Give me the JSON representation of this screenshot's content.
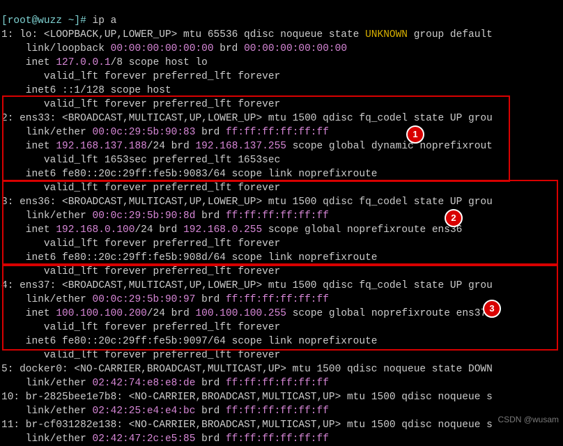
{
  "prompt": "[root@wuzz ~]# ",
  "command": "ip a",
  "watermark": "CSDN @wusam",
  "iface1": {
    "header_a": "1: lo: <LOOPBACK,UP,LOWER_UP> mtu 65536 qdisc noqueue state ",
    "state": "UNKNOWN",
    "header_b": " group default",
    "link_a": "    link/loopback ",
    "mac": "00:00:00:00:00:00",
    "link_b": " brd ",
    "brd": "00:00:00:00:00:00",
    "inet_a": "    inet ",
    "inet_ip": "127.0.0.1",
    "inet_b": "/8 scope host lo",
    "valid": "       valid_lft forever preferred_lft forever",
    "inet6": "    inet6 ::1/128 scope host",
    "valid6": "       valid_lft forever preferred_lft forever"
  },
  "iface2": {
    "header": "2: ens33: <BROADCAST,MULTICAST,UP,LOWER_UP> mtu 1500 qdisc fq_codel state UP grou",
    "link_a": "    link/ether ",
    "mac": "00:0c:29:5b:90:83",
    "link_b": " brd ",
    "brd": "ff:ff:ff:ff:ff:ff",
    "inet_a": "    inet ",
    "inet_ip": "192.168.137.188",
    "inet_b": "/24 brd ",
    "inet_brd": "192.168.137.255",
    "inet_c": " scope global dynamic noprefixrout",
    "valid": "       valid_lft 1653sec preferred_lft 1653sec",
    "inet6": "    inet6 fe80::20c:29ff:fe5b:9083/64 scope link noprefixroute",
    "valid6": "       valid_lft forever preferred_lft forever"
  },
  "iface3": {
    "header": "3: ens36: <BROADCAST,MULTICAST,UP,LOWER_UP> mtu 1500 qdisc fq_codel state UP grou",
    "link_a": "    link/ether ",
    "mac": "00:0c:29:5b:90:8d",
    "link_b": " brd ",
    "brd": "ff:ff:ff:ff:ff:ff",
    "inet_a": "    inet ",
    "inet_ip": "192.168.0.100",
    "inet_b": "/24 brd ",
    "inet_brd": "192.168.0.255",
    "inet_c": " scope global noprefixroute ens36",
    "valid": "       valid_lft forever preferred_lft forever",
    "inet6": "    inet6 fe80::20c:29ff:fe5b:908d/64 scope link noprefixroute",
    "valid6": "       valid_lft forever preferred_lft forever"
  },
  "iface4": {
    "header": "4: ens37: <BROADCAST,MULTICAST,UP,LOWER_UP> mtu 1500 qdisc fq_codel state UP grou",
    "link_a": "    link/ether ",
    "mac": "00:0c:29:5b:90:97",
    "link_b": " brd ",
    "brd": "ff:ff:ff:ff:ff:ff",
    "inet_a": "    inet ",
    "inet_ip": "100.100.100.200",
    "inet_b": "/24 brd ",
    "inet_brd": "100.100.100.255",
    "inet_c": " scope global noprefixroute ens37",
    "valid": "       valid_lft forever preferred_lft forever",
    "inet6": "    inet6 fe80::20c:29ff:fe5b:9097/64 scope link noprefixroute",
    "valid6": "       valid_lft forever preferred_lft forever"
  },
  "iface5": {
    "header": "5: docker0: <NO-CARRIER,BROADCAST,MULTICAST,UP> mtu 1500 qdisc noqueue state DOWN",
    "link_a": "    link/ether ",
    "mac": "02:42:74:e8:e8:de",
    "link_b": " brd ",
    "brd": "ff:ff:ff:ff:ff:ff"
  },
  "iface10": {
    "header": "10: br-2825bee1e7b8: <NO-CARRIER,BROADCAST,MULTICAST,UP> mtu 1500 qdisc noqueue s",
    "link_a": "    link/ether ",
    "mac": "02:42:25:e4:e4:bc",
    "link_b": " brd ",
    "brd": "ff:ff:ff:ff:ff:ff"
  },
  "iface11": {
    "header": "11: br-cf031282e138: <NO-CARRIER,BROADCAST,MULTICAST,UP> mtu 1500 qdisc noqueue s",
    "link_a": "    link/ether ",
    "mac": "02:42:47:2c:e5:85",
    "link_b": " brd ",
    "brd": "ff:ff:ff:ff:ff:ff"
  },
  "annot": {
    "b1": "1",
    "b2": "2",
    "b3": "3"
  }
}
